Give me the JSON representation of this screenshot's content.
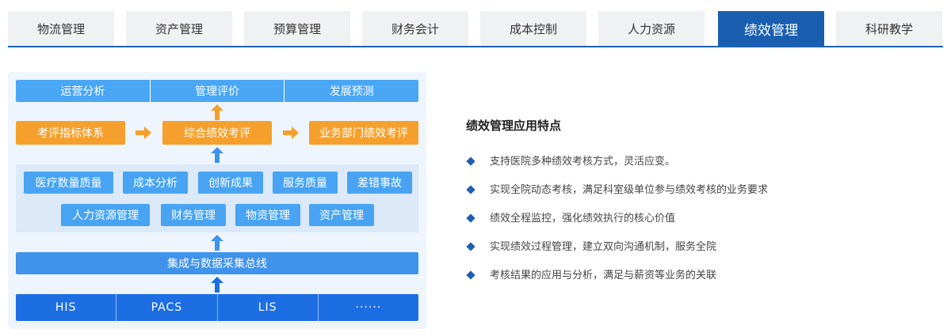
{
  "tabs": [
    {
      "label": "物流管理",
      "active": false
    },
    {
      "label": "资产管理",
      "active": false
    },
    {
      "label": "预算管理",
      "active": false
    },
    {
      "label": "财务会计",
      "active": false
    },
    {
      "label": "成本控制",
      "active": false
    },
    {
      "label": "人力资源",
      "active": false
    },
    {
      "label": "绩效管理",
      "active": true
    },
    {
      "label": "科研教学",
      "active": false
    }
  ],
  "diagram": {
    "top": [
      "运营分析",
      "管理评价",
      "发展预测"
    ],
    "middle": [
      "考评指标体系",
      "综合绩效考评",
      "业务部门绩效考评"
    ],
    "modules_row1": [
      "医疗数量质量",
      "成本分析",
      "创新成果",
      "服务质量",
      "差错事故"
    ],
    "modules_row2": [
      "人力资源管理",
      "财务管理",
      "物资管理",
      "资产管理"
    ],
    "bus": "集成与数据采集总线",
    "systems": [
      "HIS",
      "PACS",
      "LIS",
      "······"
    ]
  },
  "features": {
    "title": "绩效管理应用特点",
    "items": [
      "支持医院多种绩效考核方式，灵活应变。",
      "实现全院动态考核，满足科室级单位参与绩效考核的业务要求",
      "绩效全程监控，强化绩效执行的核心价值",
      "实现绩效过程管理，建立双向沟通机制，服务全院",
      "考核结果的应用与分析，满足与薪资等业务的关联"
    ]
  },
  "colors": {
    "tab_active": "#1a5faf",
    "tab_inactive": "#f0f1f3",
    "light_blue": "#4aa7f5",
    "orange": "#f5a02d",
    "dark_blue": "#1d6ee3",
    "bullet": "#1e5fb0"
  },
  "icons": [
    "arrow-up-icon",
    "arrow-right-icon",
    "diamond-bullet-icon"
  ]
}
